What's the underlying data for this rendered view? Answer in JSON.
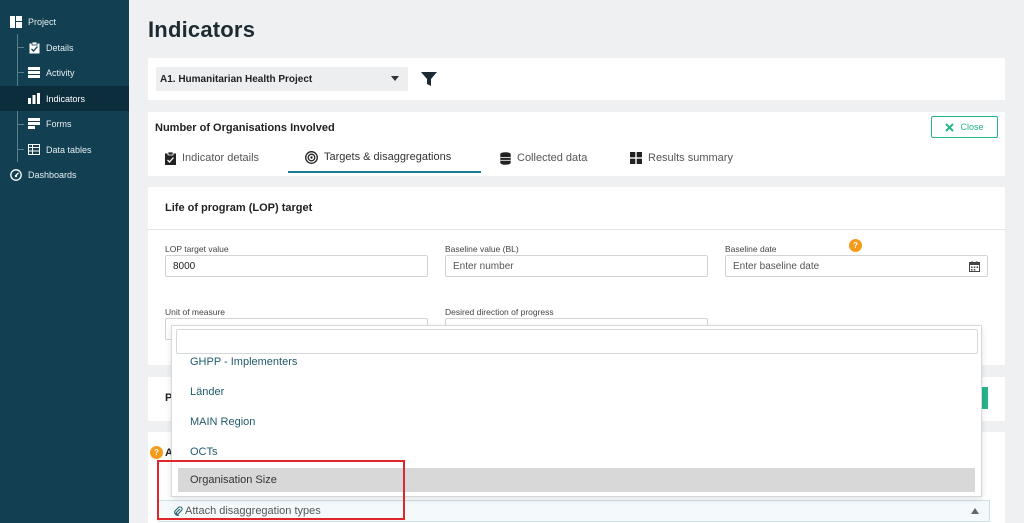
{
  "sidebar": {
    "project": "Project",
    "items": [
      {
        "label": "Details",
        "icon": "clipboard-icon"
      },
      {
        "label": "Activity",
        "icon": "list-icon"
      },
      {
        "label": "Indicators",
        "icon": "bar-chart-icon"
      },
      {
        "label": "Forms",
        "icon": "forms-icon"
      },
      {
        "label": "Data tables",
        "icon": "table-icon"
      }
    ],
    "dashboards": "Dashboards",
    "active_item": "Indicators"
  },
  "page": {
    "title": "Indicators"
  },
  "project_selector": {
    "value": "A1. Humanitarian Health Project"
  },
  "indicator": {
    "name": "Number of Organisations Involved",
    "close_label": "Close",
    "tabs": [
      {
        "label": "Indicator details",
        "icon": "clipboard-icon"
      },
      {
        "label": "Targets & disaggregations",
        "icon": "target-icon"
      },
      {
        "label": "Collected data",
        "icon": "database-icon"
      },
      {
        "label": "Results summary",
        "icon": "grid-icon"
      }
    ],
    "active_tab": "Targets & disaggregations"
  },
  "lop": {
    "title": "Life of program (LOP) target",
    "target_label": "LOP target value",
    "target_value": "8000",
    "baseline_label": "Baseline value (BL)",
    "baseline_placeholder": "Enter number",
    "baseline_date_label": "Baseline date",
    "baseline_date_placeholder": "Enter baseline date",
    "unit_label": "Unit of measure",
    "direction_label": "Desired direction of progress",
    "help": "?"
  },
  "cards": {
    "p_label": "P",
    "a_label": "A"
  },
  "dropdown": {
    "options": [
      "GHPP - Implementers",
      "Länder",
      "MAIN Region",
      "OCTs",
      "Organisation Size"
    ],
    "highlighted": "Organisation Size"
  },
  "attach": {
    "label": "Attach disaggregation types"
  },
  "colors": {
    "sidebar": "#124052",
    "accent": "#27b58b",
    "help": "#f59b1b",
    "highlight": "#e0252b"
  }
}
